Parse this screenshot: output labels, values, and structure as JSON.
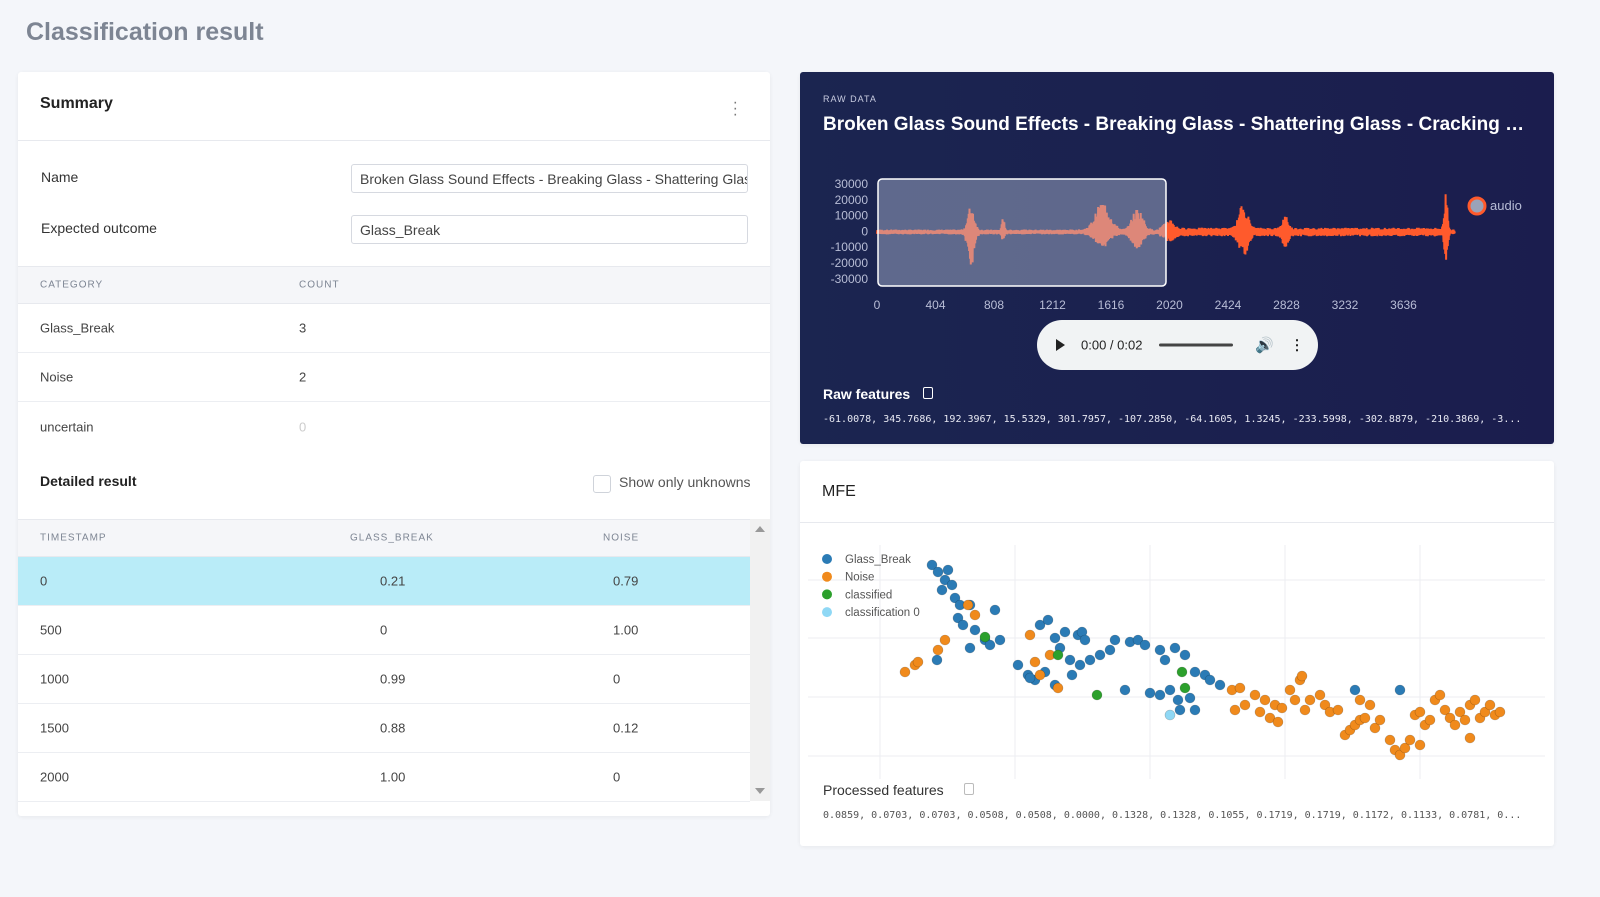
{
  "page_title": "Classification result",
  "summary": {
    "title": "Summary",
    "name_label": "Name",
    "name_value": "Broken Glass Sound Effects - Breaking Glass - Shattering Glass",
    "expected_label": "Expected outcome",
    "expected_value": "Glass_Break",
    "category_header": "CATEGORY",
    "count_header": "COUNT",
    "categories": [
      {
        "name": "Glass_Break",
        "count": "3"
      },
      {
        "name": "Noise",
        "count": "2"
      },
      {
        "name": "uncertain",
        "count": "0"
      }
    ]
  },
  "detailed": {
    "title": "Detailed result",
    "show_unknowns_label": "Show only unknowns",
    "show_unknowns_checked": false,
    "headers": [
      "TIMESTAMP",
      "GLASS_BREAK",
      "NOISE"
    ],
    "rows": [
      [
        "0",
        "0.21",
        "0.79"
      ],
      [
        "500",
        "0",
        "1.00"
      ],
      [
        "1000",
        "0.99",
        "0"
      ],
      [
        "1500",
        "0.88",
        "0.12"
      ],
      [
        "2000",
        "1.00",
        "0"
      ]
    ],
    "selected_row": 0
  },
  "raw": {
    "label": "RAW DATA",
    "title": "Broken Glass Sound Effects - Breaking Glass - Shattering Glass - Cracking Glass",
    "y_ticks": [
      "30000",
      "20000",
      "10000",
      "0",
      "-10000",
      "-20000",
      "-30000"
    ],
    "x_ticks": [
      "0",
      "404",
      "808",
      "1212",
      "1616",
      "2020",
      "2424",
      "2828",
      "3232",
      "3636"
    ],
    "legend": "audio",
    "wave_color": "#ff5a2c",
    "player": {
      "time": "0:00 / 0:02"
    },
    "features_label": "Raw features",
    "features": "-61.0078, 345.7686, 192.3967, 15.5329, 301.7957, -107.2850, -64.1605, 1.3245, -233.5998, -302.8879, -210.3869, -3..."
  },
  "mfe": {
    "title": "MFE",
    "features_label": "Processed features",
    "features": "0.0859, 0.0703, 0.0703, 0.0508, 0.0508, 0.0000, 0.1328, 0.1328, 0.1055, 0.1719, 0.1719, 0.1172, 0.1133, 0.0781, 0...",
    "series": [
      {
        "name": "Glass_Break",
        "color": "#2b7bb5",
        "points": [
          [
            132,
            235
          ],
          [
            138,
            228
          ],
          [
            148,
            230
          ],
          [
            145,
            220
          ],
          [
            152,
            215
          ],
          [
            142,
            210
          ],
          [
            155,
            202
          ],
          [
            160,
            195
          ],
          [
            170,
            195
          ],
          [
            195,
            190
          ],
          [
            158,
            182
          ],
          [
            163,
            175
          ],
          [
            175,
            170
          ],
          [
            185,
            160
          ],
          [
            190,
            155
          ],
          [
            200,
            160
          ],
          [
            170,
            152
          ],
          [
            137,
            140
          ],
          [
            240,
            175
          ],
          [
            248,
            180
          ],
          [
            255,
            162
          ],
          [
            265,
            168
          ],
          [
            278,
            165
          ],
          [
            282,
            168
          ],
          [
            260,
            152
          ],
          [
            270,
            140
          ],
          [
            280,
            135
          ],
          [
            290,
            140
          ],
          [
            300,
            145
          ],
          [
            310,
            150
          ],
          [
            315,
            160
          ],
          [
            330,
            158
          ],
          [
            338,
            160
          ],
          [
            345,
            155
          ],
          [
            360,
            150
          ],
          [
            375,
            152
          ],
          [
            365,
            140
          ],
          [
            385,
            145
          ],
          [
            395,
            128
          ],
          [
            405,
            125
          ],
          [
            410,
            120
          ],
          [
            420,
            115
          ],
          [
            218,
            135
          ],
          [
            228,
            125
          ],
          [
            235,
            120
          ],
          [
            245,
            128
          ],
          [
            255,
            115
          ],
          [
            272,
            125
          ],
          [
            325,
            110
          ],
          [
            350,
            107
          ],
          [
            360,
            105
          ],
          [
            370,
            110
          ],
          [
            378,
            100
          ],
          [
            390,
            102
          ],
          [
            395,
            90
          ],
          [
            380,
            90
          ],
          [
            555,
            110
          ],
          [
            600,
            110
          ],
          [
            285,
            160
          ],
          [
            230,
            122
          ]
        ]
      },
      {
        "name": "Noise",
        "color": "#f08a1c",
        "points": [
          [
            105,
            128
          ],
          [
            115,
            135
          ],
          [
            118,
            138
          ],
          [
            138,
            150
          ],
          [
            145,
            160
          ],
          [
            168,
            195
          ],
          [
            175,
            185
          ],
          [
            230,
            165
          ],
          [
            235,
            138
          ],
          [
            240,
            125
          ],
          [
            250,
            145
          ],
          [
            258,
            112
          ],
          [
            432,
            110
          ],
          [
            440,
            112
          ],
          [
            435,
            90
          ],
          [
            445,
            95
          ],
          [
            455,
            105
          ],
          [
            460,
            88
          ],
          [
            465,
            100
          ],
          [
            470,
            82
          ],
          [
            475,
            95
          ],
          [
            478,
            78
          ],
          [
            482,
            92
          ],
          [
            490,
            110
          ],
          [
            495,
            100
          ],
          [
            500,
            120
          ],
          [
            502,
            124
          ],
          [
            505,
            90
          ],
          [
            510,
            100
          ],
          [
            520,
            105
          ],
          [
            525,
            95
          ],
          [
            530,
            88
          ],
          [
            538,
            90
          ],
          [
            545,
            65
          ],
          [
            550,
            70
          ],
          [
            555,
            75
          ],
          [
            560,
            80
          ],
          [
            565,
            82
          ],
          [
            570,
            95
          ],
          [
            575,
            72
          ],
          [
            580,
            80
          ],
          [
            590,
            60
          ],
          [
            595,
            50
          ],
          [
            600,
            45
          ],
          [
            605,
            52
          ],
          [
            610,
            60
          ],
          [
            615,
            85
          ],
          [
            620,
            88
          ],
          [
            625,
            75
          ],
          [
            630,
            80
          ],
          [
            635,
            100
          ],
          [
            640,
            105
          ],
          [
            645,
            90
          ],
          [
            650,
            82
          ],
          [
            655,
            75
          ],
          [
            660,
            88
          ],
          [
            665,
            80
          ],
          [
            670,
            95
          ],
          [
            675,
            100
          ],
          [
            680,
            82
          ],
          [
            685,
            88
          ],
          [
            690,
            95
          ],
          [
            695,
            85
          ],
          [
            700,
            88
          ],
          [
            670,
            62
          ],
          [
            620,
            55
          ],
          [
            560,
            100
          ]
        ]
      },
      {
        "name": "classified",
        "color": "#2ca02c",
        "points": [
          [
            185,
            163
          ],
          [
            258,
            145
          ],
          [
            297,
            105
          ],
          [
            382,
            128
          ],
          [
            385,
            112
          ]
        ]
      },
      {
        "name": "classification 0",
        "color": "#8fd8f5",
        "points": [
          [
            370,
            85
          ]
        ]
      }
    ]
  }
}
